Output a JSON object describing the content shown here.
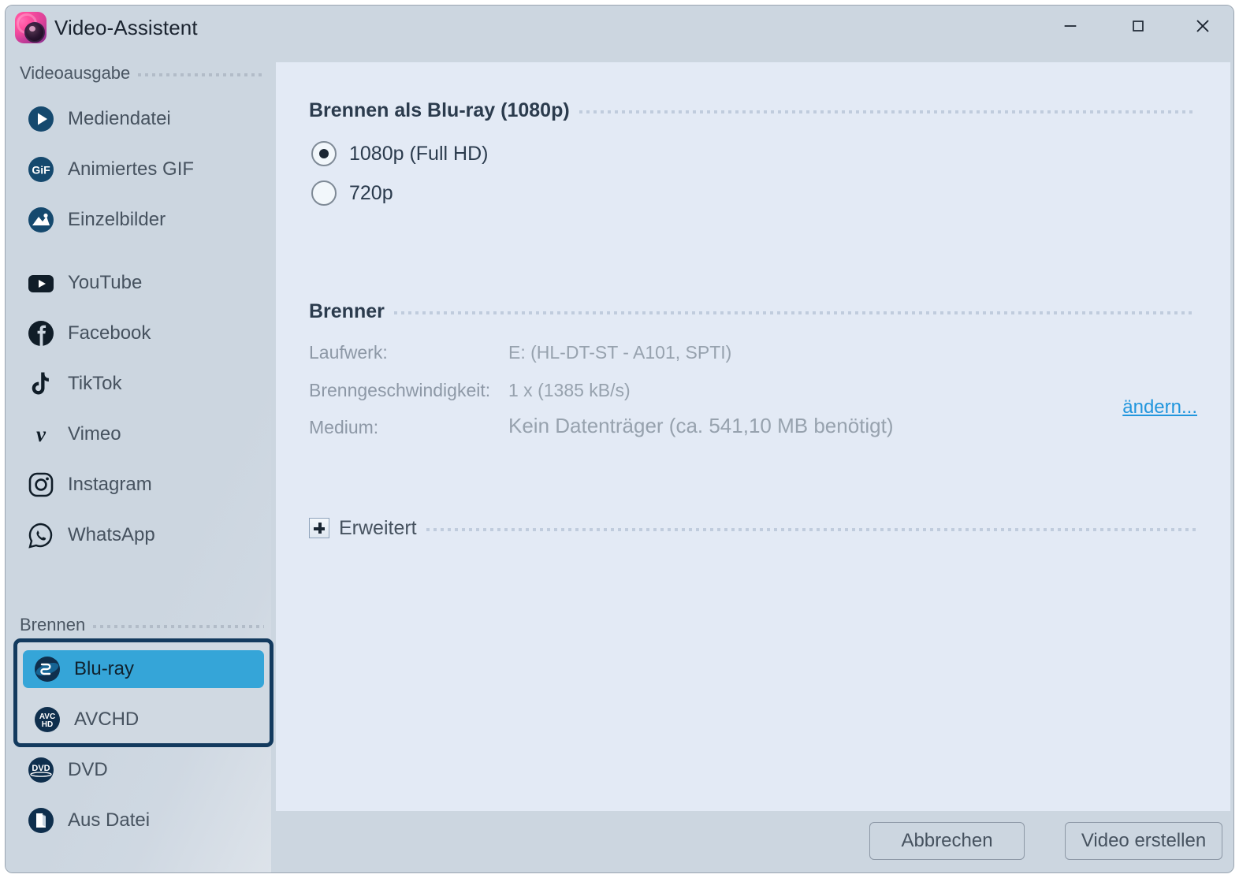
{
  "window": {
    "title": "Video-Assistent",
    "app_icon": "video-assistant-app-icon",
    "controls": {
      "minimize": "minimize-icon",
      "maximize": "maximize-icon",
      "close": "close-icon"
    }
  },
  "sidebar": {
    "groups": [
      {
        "label": "Videoausgabe",
        "items": [
          {
            "label": "Mediendatei",
            "icon": "play-circle-icon",
            "selected": false
          },
          {
            "label": "Animiertes GIF",
            "icon": "gif-circle-icon",
            "selected": false
          },
          {
            "label": "Einzelbilder",
            "icon": "image-circle-icon",
            "selected": false
          },
          {
            "label": "YouTube",
            "icon": "youtube-icon",
            "selected": false
          },
          {
            "label": "Facebook",
            "icon": "facebook-icon",
            "selected": false
          },
          {
            "label": "TikTok",
            "icon": "tiktok-icon",
            "selected": false
          },
          {
            "label": "Vimeo",
            "icon": "vimeo-icon",
            "selected": false
          },
          {
            "label": "Instagram",
            "icon": "instagram-icon",
            "selected": false
          },
          {
            "label": "WhatsApp",
            "icon": "whatsapp-icon",
            "selected": false
          }
        ]
      },
      {
        "label": "Brennen",
        "items": [
          {
            "label": "Blu-ray",
            "icon": "bluray-icon",
            "selected": true
          },
          {
            "label": "AVCHD",
            "icon": "avchd-icon",
            "selected": false
          },
          {
            "label": "DVD",
            "icon": "dvd-icon",
            "selected": false
          },
          {
            "label": "Aus Datei",
            "icon": "from-file-icon",
            "selected": false
          }
        ]
      }
    ]
  },
  "main": {
    "format_section": {
      "title": "Brennen als Blu-ray (1080p)",
      "options": [
        {
          "label": "1080p (Full HD)",
          "selected": true
        },
        {
          "label": "720p",
          "selected": false
        }
      ]
    },
    "burner_section": {
      "title": "Brenner",
      "change_link": "ändern...",
      "rows": [
        {
          "label": "Laufwerk:",
          "value": "E: (HL-DT-ST - A101, SPTI)"
        },
        {
          "label": "Brenngeschwindigkeit:",
          "value": "1 x (1385 kB/s)"
        },
        {
          "label": "Medium:",
          "value": "Kein Datenträger (ca. 541,10 MB benötigt)"
        }
      ]
    },
    "advanced_section": {
      "label": "Erweitert",
      "expand_icon": "plus-box-icon",
      "expanded": false
    }
  },
  "footer": {
    "cancel_label": "Abbrechen",
    "create_label": "Video erstellen"
  },
  "colors": {
    "window_bg": "#ccd6e0",
    "content_bg": "#e3eaf5",
    "selection": "#35a5d8",
    "highlight_border": "#133a5e",
    "link": "#2196dd",
    "icon_navy": "#15496e"
  }
}
